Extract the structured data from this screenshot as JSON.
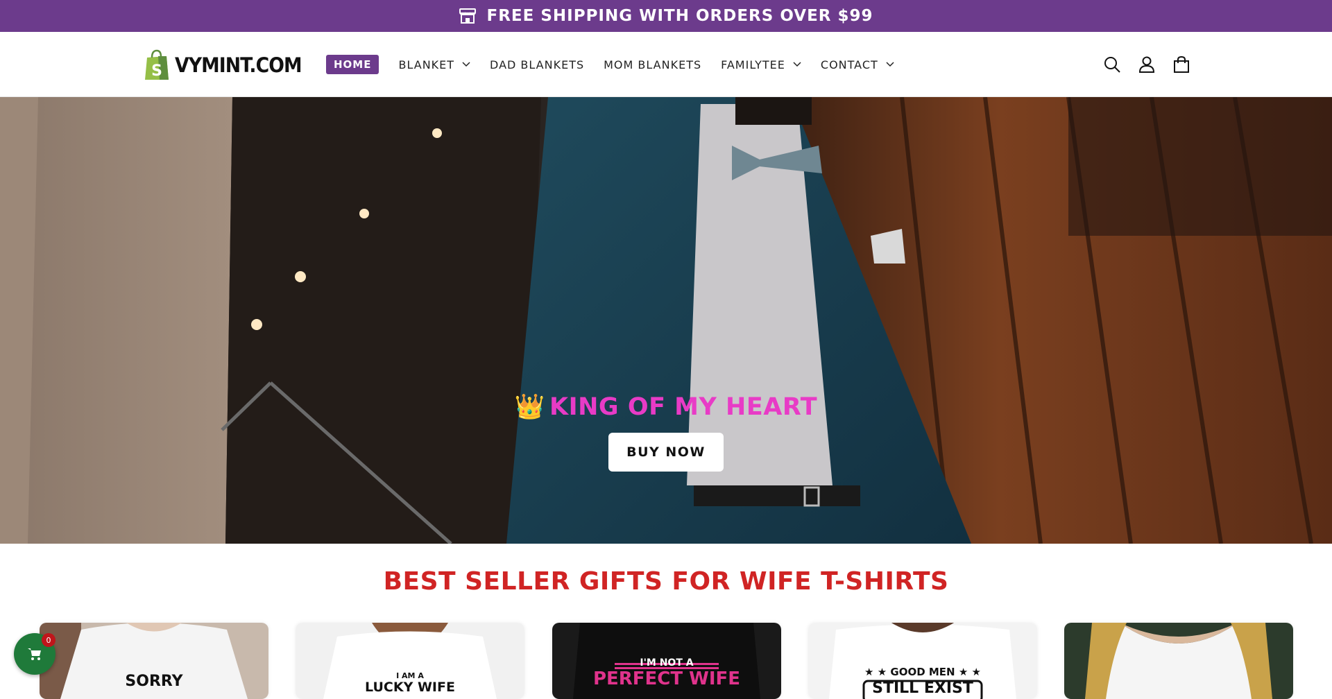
{
  "announcement": {
    "text": "FREE SHIPPING WITH ORDERS OVER $99",
    "icon": "storefront-icon",
    "bg_color": "#6c3b8c"
  },
  "header": {
    "logo_text": "VYMINT.COM",
    "logo_icon": "shopping-bag-logo",
    "nav": [
      {
        "label": "HOME",
        "active": true,
        "has_dropdown": false
      },
      {
        "label": "BLANKET",
        "active": false,
        "has_dropdown": true
      },
      {
        "label": "DAD BLANKETS",
        "active": false,
        "has_dropdown": false
      },
      {
        "label": "MOM BLANKETS",
        "active": false,
        "has_dropdown": false
      },
      {
        "label": "FAMILYTEE",
        "active": false,
        "has_dropdown": true
      },
      {
        "label": "CONTACT",
        "active": false,
        "has_dropdown": true
      }
    ],
    "icons": [
      "search-icon",
      "account-icon",
      "cart-icon"
    ]
  },
  "hero": {
    "heading_emoji": "👑",
    "heading": "KING OF MY HEART",
    "button_label": "BUY NOW",
    "heading_color": "#e83bc6"
  },
  "best_seller": {
    "title": "BEST SELLER GIFTS FOR WIFE T-SHIRTS",
    "title_color": "#d02424",
    "cards": [
      {
        "text": "SORRY",
        "theme": "white"
      },
      {
        "text_line1": "I AM A",
        "text_line2": "LUCKY WIFE",
        "theme": "white"
      },
      {
        "text_line1": "I'M NOT A",
        "text_line2": "PERFECT WIFE",
        "theme": "black"
      },
      {
        "text_line1": "★ ★ GOOD MEN ★ ★",
        "text_line2": "STILL EXIST",
        "theme": "white"
      },
      {
        "text": "",
        "theme": "white"
      }
    ]
  },
  "floating_cart": {
    "count": "0",
    "bg_color": "#1f7a3a"
  }
}
